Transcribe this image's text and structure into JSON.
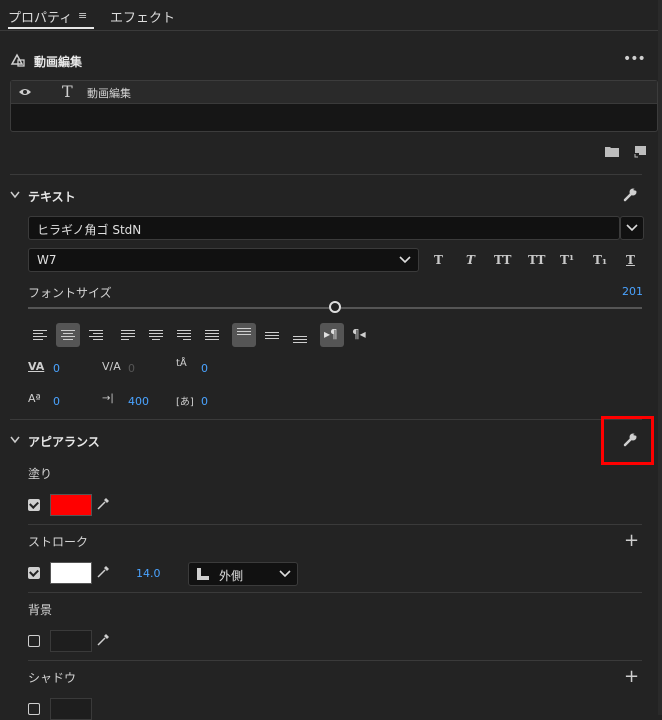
{
  "tabs": [
    {
      "label": "プロパティ",
      "menu_icon": "hamburger-icon",
      "active": true
    },
    {
      "label": "エフェクト",
      "active": false
    }
  ],
  "clip": {
    "title": "動画編集",
    "more_icon": "more-icon"
  },
  "layer": {
    "name": "動画編集",
    "visibility_icon": "eye-icon",
    "type_icon": "text-tool-icon"
  },
  "text_section": {
    "title": "テキスト",
    "font_family": "ヒラギノ角ゴ StdN",
    "font_style": "W7",
    "style_buttons": [
      "T",
      "T",
      "TT",
      "TT",
      "T¹",
      "T₁",
      "T"
    ],
    "font_size_label": "フォントサイズ",
    "font_size_value": "201",
    "font_size_fraction": 0.5,
    "kerning": "0",
    "tracking": "0",
    "leading": "0",
    "baseline_shift": "0",
    "tab_width": "400",
    "tsume": "0"
  },
  "appearance": {
    "title": "アピアランス",
    "fill_label": "塗り",
    "fill_checked": true,
    "fill_color": "#ff0000",
    "stroke_label": "ストローク",
    "stroke_checked": true,
    "stroke_color": "#ffffff",
    "stroke_width": "14.0",
    "stroke_position": "外側",
    "background_label": "背景",
    "background_checked": false,
    "shadow_label": "シャドウ",
    "shadow_checked": false
  },
  "highlight_color": "#ff0000"
}
